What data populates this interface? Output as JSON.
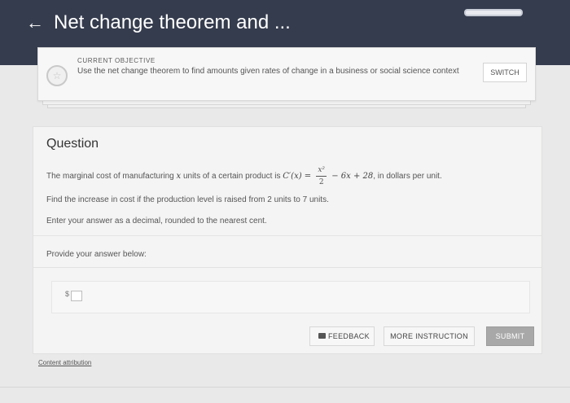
{
  "header": {
    "back_icon": "left-arrow-icon",
    "back_glyph": "←",
    "title": "Net change theorem and ..."
  },
  "objective": {
    "badge_icon": "star-icon",
    "badge_glyph": "☆",
    "label": "CURRENT OBJECTIVE",
    "text": "Use the net change theorem to find amounts given rates of change in a business or social science context",
    "switch_label": "SWITCH"
  },
  "question": {
    "heading": "Question",
    "text_before": "The marginal cost of manufacturing ",
    "var_x": "x",
    "text_mid": " units of a certain product is ",
    "formula_lhs": "C′(x) = ",
    "frac_num": "x²",
    "frac_den": "2",
    "formula_rhs": " − 6x + 28",
    "text_after": ", in dollars per unit.",
    "line2": "Find the increase in cost if the production level is raised from 2 units to 7 units.",
    "line3": "Enter your answer as a decimal, rounded to the nearest cent."
  },
  "answer": {
    "provide_label": "Provide your answer below:",
    "currency_symbol": "$",
    "value": ""
  },
  "actions": {
    "feedback_icon": "feedback-icon",
    "feedback_label": "FEEDBACK",
    "more_label": "MORE INSTRUCTION",
    "submit_label": "SUBMIT"
  },
  "footer": {
    "attribution": "Content attribution"
  },
  "colors": {
    "header_bg": "#353c4e",
    "page_bg": "#e9e9ea",
    "submit_bg": "#a8a8a8"
  }
}
